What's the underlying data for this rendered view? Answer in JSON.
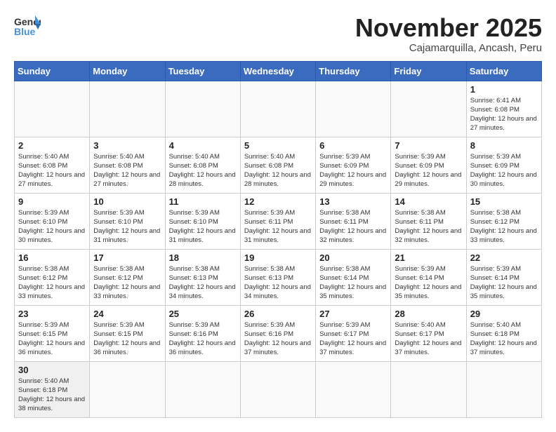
{
  "header": {
    "logo_general": "General",
    "logo_blue": "Blue",
    "title": "November 2025",
    "subtitle": "Cajamarquilla, Ancash, Peru"
  },
  "weekdays": [
    "Sunday",
    "Monday",
    "Tuesday",
    "Wednesday",
    "Thursday",
    "Friday",
    "Saturday"
  ],
  "days": {
    "1": {
      "sunrise": "6:41 AM",
      "sunset": "6:08 PM",
      "daylight": "12 hours and 27 minutes."
    },
    "2": {
      "sunrise": "5:40 AM",
      "sunset": "6:08 PM",
      "daylight": "12 hours and 27 minutes."
    },
    "3": {
      "sunrise": "5:40 AM",
      "sunset": "6:08 PM",
      "daylight": "12 hours and 27 minutes."
    },
    "4": {
      "sunrise": "5:40 AM",
      "sunset": "6:08 PM",
      "daylight": "12 hours and 28 minutes."
    },
    "5": {
      "sunrise": "5:40 AM",
      "sunset": "6:08 PM",
      "daylight": "12 hours and 28 minutes."
    },
    "6": {
      "sunrise": "5:39 AM",
      "sunset": "6:09 PM",
      "daylight": "12 hours and 29 minutes."
    },
    "7": {
      "sunrise": "5:39 AM",
      "sunset": "6:09 PM",
      "daylight": "12 hours and 29 minutes."
    },
    "8": {
      "sunrise": "5:39 AM",
      "sunset": "6:09 PM",
      "daylight": "12 hours and 30 minutes."
    },
    "9": {
      "sunrise": "5:39 AM",
      "sunset": "6:10 PM",
      "daylight": "12 hours and 30 minutes."
    },
    "10": {
      "sunrise": "5:39 AM",
      "sunset": "6:10 PM",
      "daylight": "12 hours and 31 minutes."
    },
    "11": {
      "sunrise": "5:39 AM",
      "sunset": "6:10 PM",
      "daylight": "12 hours and 31 minutes."
    },
    "12": {
      "sunrise": "5:39 AM",
      "sunset": "6:11 PM",
      "daylight": "12 hours and 31 minutes."
    },
    "13": {
      "sunrise": "5:38 AM",
      "sunset": "6:11 PM",
      "daylight": "12 hours and 32 minutes."
    },
    "14": {
      "sunrise": "5:38 AM",
      "sunset": "6:11 PM",
      "daylight": "12 hours and 32 minutes."
    },
    "15": {
      "sunrise": "5:38 AM",
      "sunset": "6:12 PM",
      "daylight": "12 hours and 33 minutes."
    },
    "16": {
      "sunrise": "5:38 AM",
      "sunset": "6:12 PM",
      "daylight": "12 hours and 33 minutes."
    },
    "17": {
      "sunrise": "5:38 AM",
      "sunset": "6:12 PM",
      "daylight": "12 hours and 33 minutes."
    },
    "18": {
      "sunrise": "5:38 AM",
      "sunset": "6:13 PM",
      "daylight": "12 hours and 34 minutes."
    },
    "19": {
      "sunrise": "5:38 AM",
      "sunset": "6:13 PM",
      "daylight": "12 hours and 34 minutes."
    },
    "20": {
      "sunrise": "5:38 AM",
      "sunset": "6:14 PM",
      "daylight": "12 hours and 35 minutes."
    },
    "21": {
      "sunrise": "5:39 AM",
      "sunset": "6:14 PM",
      "daylight": "12 hours and 35 minutes."
    },
    "22": {
      "sunrise": "5:39 AM",
      "sunset": "6:14 PM",
      "daylight": "12 hours and 35 minutes."
    },
    "23": {
      "sunrise": "5:39 AM",
      "sunset": "6:15 PM",
      "daylight": "12 hours and 36 minutes."
    },
    "24": {
      "sunrise": "5:39 AM",
      "sunset": "6:15 PM",
      "daylight": "12 hours and 36 minutes."
    },
    "25": {
      "sunrise": "5:39 AM",
      "sunset": "6:16 PM",
      "daylight": "12 hours and 36 minutes."
    },
    "26": {
      "sunrise": "5:39 AM",
      "sunset": "6:16 PM",
      "daylight": "12 hours and 37 minutes."
    },
    "27": {
      "sunrise": "5:39 AM",
      "sunset": "6:17 PM",
      "daylight": "12 hours and 37 minutes."
    },
    "28": {
      "sunrise": "5:40 AM",
      "sunset": "6:17 PM",
      "daylight": "12 hours and 37 minutes."
    },
    "29": {
      "sunrise": "5:40 AM",
      "sunset": "6:18 PM",
      "daylight": "12 hours and 37 minutes."
    },
    "30": {
      "sunrise": "5:40 AM",
      "sunset": "6:18 PM",
      "daylight": "12 hours and 38 minutes."
    }
  },
  "labels": {
    "sunrise": "Sunrise:",
    "sunset": "Sunset:",
    "daylight": "Daylight:"
  }
}
